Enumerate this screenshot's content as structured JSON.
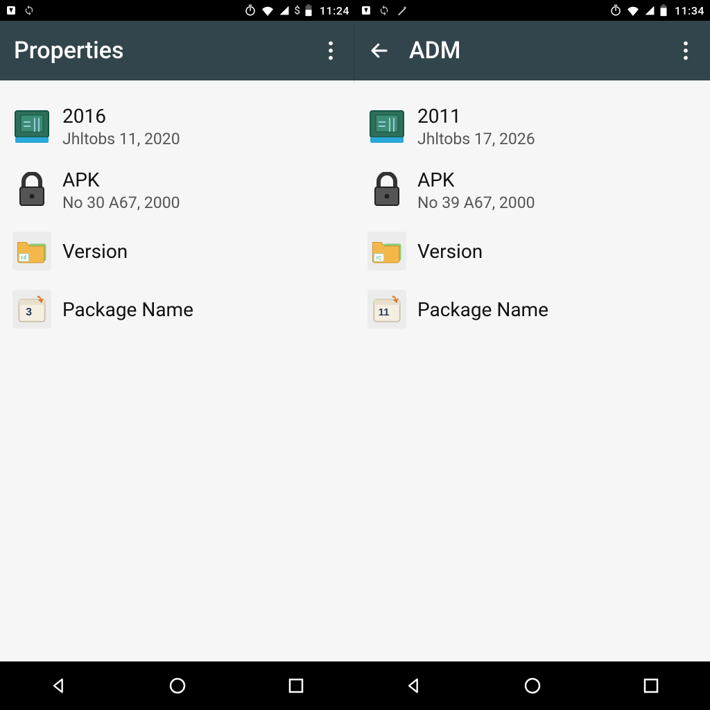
{
  "screens": [
    {
      "statusbar": {
        "clock": "11:24",
        "extra": "$"
      },
      "appbar": {
        "has_back": false,
        "title": "Properties"
      },
      "items": [
        {
          "icon": "floppy-icon",
          "icon_text": "",
          "title": "2016",
          "sub": "Jhltobs 11, 2020"
        },
        {
          "icon": "lock-icon",
          "icon_text": "",
          "title": "APK",
          "sub": "No 30 A67, 2000"
        },
        {
          "icon": "folder-icon",
          "icon_text": "r4",
          "title": "Version",
          "sub": ""
        },
        {
          "icon": "calendar-icon",
          "icon_text": "3",
          "title": "Package Name",
          "sub": ""
        }
      ]
    },
    {
      "statusbar": {
        "clock": "11:34",
        "extra": ""
      },
      "appbar": {
        "has_back": true,
        "title": "ADM"
      },
      "items": [
        {
          "icon": "floppy-icon",
          "icon_text": "",
          "title": "2011",
          "sub": "Jhltobs 17, 2026"
        },
        {
          "icon": "lock-icon",
          "icon_text": "",
          "title": "APK",
          "sub": "No 39 A67, 2000"
        },
        {
          "icon": "folder-icon",
          "icon_text": "rc",
          "title": "Version",
          "sub": ""
        },
        {
          "icon": "calendar-icon",
          "icon_text": "11",
          "title": "Package Name",
          "sub": ""
        }
      ]
    }
  ]
}
